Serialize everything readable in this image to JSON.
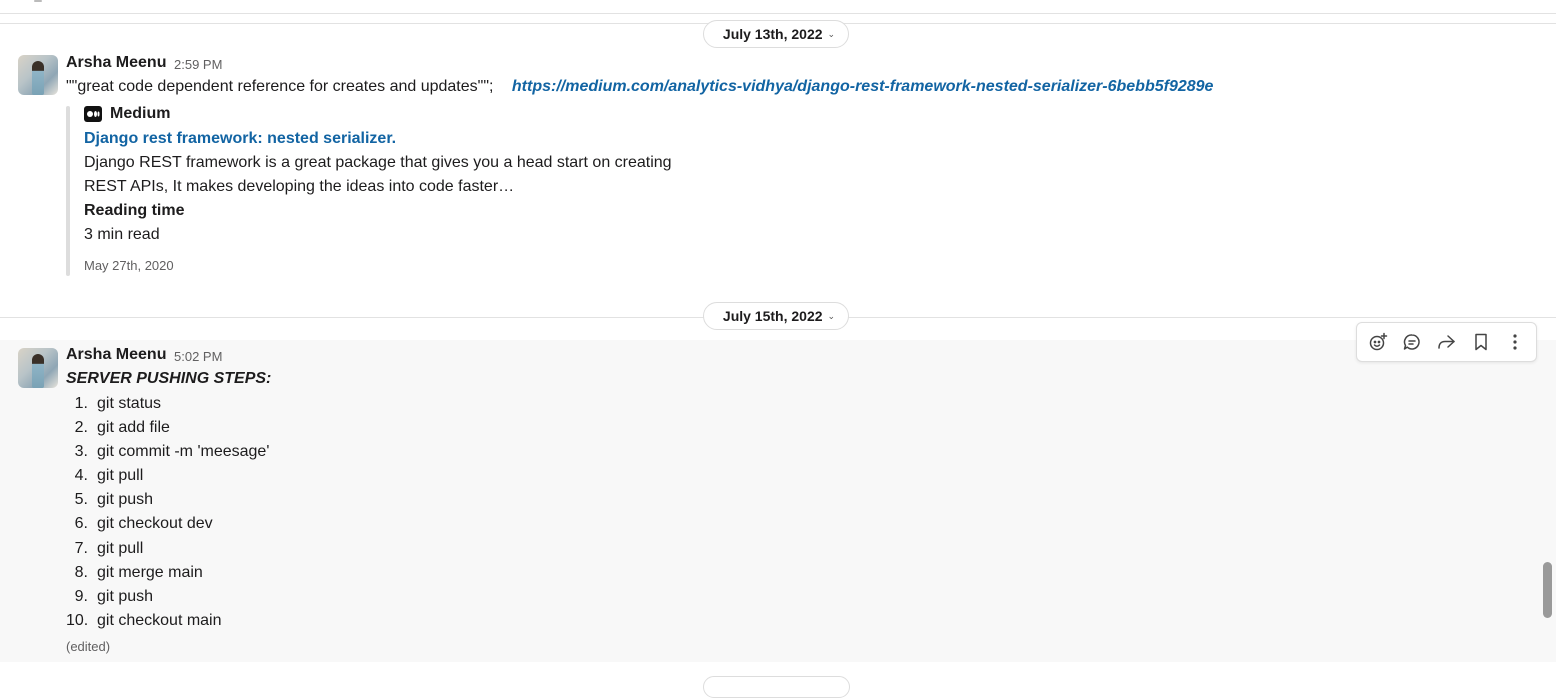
{
  "dates": {
    "first": "July 13th, 2022",
    "second": "July 15th, 2022"
  },
  "message1": {
    "author": "Arsha Meenu",
    "time": "2:59 PM",
    "text": "\"\"great code dependent reference for creates and  updates\"\";",
    "link": "https://medium.com/analytics-vidhya/django-rest-framework-nested-serializer-6bebb5f9289e",
    "attachment": {
      "source": "Medium",
      "title": "Django rest framework: nested serializer.",
      "description_line1": "Django REST framework is a great package that gives you a head start on creating",
      "description_line2": "REST APIs, It makes developing the ideas into code faster…",
      "field_label": "Reading time",
      "field_value": "3 min read",
      "date": "May 27th, 2020"
    }
  },
  "message2": {
    "author": "Arsha Meenu",
    "time": "5:02 PM",
    "heading": "SERVER PUSHING STEPS:",
    "steps": [
      {
        "num": "1.",
        "text": "git status"
      },
      {
        "num": "2.",
        "text": "git add file"
      },
      {
        "num": "3.",
        "text": "git commit -m 'meesage'"
      },
      {
        "num": "4.",
        "text": "git pull"
      },
      {
        "num": "5.",
        "text": "git push"
      },
      {
        "num": "6.",
        "text": "git checkout dev"
      },
      {
        "num": "7.",
        "text": "git pull"
      },
      {
        "num": "8.",
        "text": "git merge main"
      },
      {
        "num": "9.",
        "text": "git push"
      },
      {
        "num": "10.",
        "text": "git checkout main"
      }
    ],
    "edited": "(edited)"
  },
  "toolbar_icons": [
    "add-reaction-icon",
    "reply-thread-icon",
    "forward-icon",
    "bookmark-icon",
    "more-actions-icon"
  ],
  "colors": {
    "link": "#1264a3",
    "hover_bg": "#f8f8f8",
    "muted": "#616061"
  }
}
